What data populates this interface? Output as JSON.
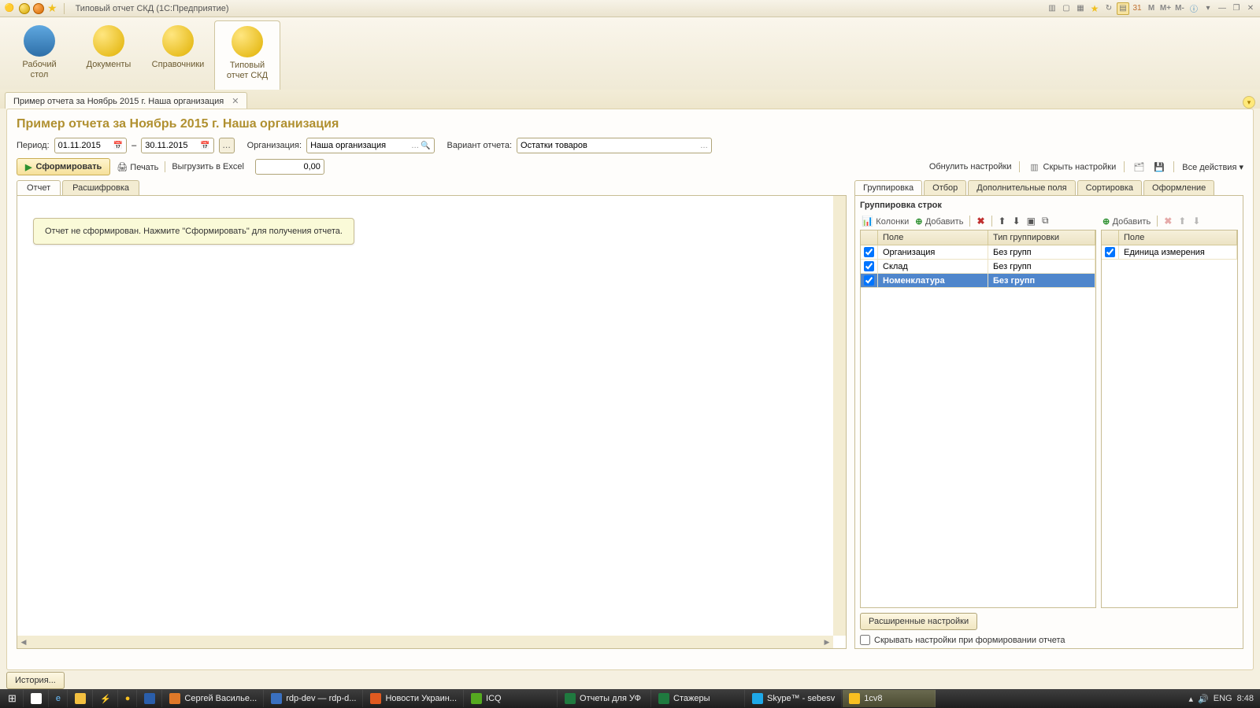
{
  "titlebar": {
    "title": "Типовый отчет СКД  (1С:Предприятие)",
    "memory": {
      "m": "M",
      "mplus": "M+",
      "mminus": "M-"
    }
  },
  "nav": {
    "items": [
      {
        "label": "Рабочий\nстол"
      },
      {
        "label": "Документы"
      },
      {
        "label": "Справочники"
      },
      {
        "label": "Типовый\nотчет СКД"
      }
    ]
  },
  "doctab": {
    "label": "Пример отчета за Ноябрь 2015 г. Наша организация"
  },
  "page": {
    "title": "Пример отчета за Ноябрь 2015 г. Наша организация",
    "period_label": "Период:",
    "period_from": "01.11.2015",
    "period_to": "30.11.2015",
    "dash": "–",
    "org_label": "Организация:",
    "org_value": "Наша организация",
    "variant_label": "Вариант отчета:",
    "variant_value": "Остатки товаров",
    "form_btn": "Сформировать",
    "print_btn": "Печать",
    "export_btn": "Выгрузить в Excel",
    "num_value": "0,00",
    "reset_link": "Обнулить настройки",
    "hide_link": "Скрыть настройки",
    "all_actions": "Все действия",
    "tabs": {
      "report": "Отчет",
      "drill": "Расшифровка"
    },
    "placeholder_msg": "Отчет не сформирован. Нажмите \"Сформировать\" для получения отчета."
  },
  "right": {
    "tabs": [
      "Группировка",
      "Отбор",
      "Дополнительные поля",
      "Сортировка",
      "Оформление"
    ],
    "title": "Группировка строк",
    "btn_columns": "Колонки",
    "btn_add": "Добавить",
    "gridA": {
      "h1": "Поле",
      "h2": "Тип группировки",
      "rows": [
        {
          "f": "Организация",
          "t": "Без групп",
          "sel": false
        },
        {
          "f": "Склад",
          "t": "Без групп",
          "sel": false
        },
        {
          "f": "Номенклатура",
          "t": "Без групп",
          "sel": true
        }
      ]
    },
    "gridB": {
      "h1": "Поле",
      "btn_add": "Добавить",
      "rows": [
        {
          "f": "Единица измерения"
        }
      ]
    },
    "adv_btn": "Расширенные настройки",
    "hide_chk": "Скрывать настройки при формировании отчета"
  },
  "history": {
    "btn": "История..."
  },
  "taskbar": {
    "tasks": [
      "Сергей Василье...",
      "rdp-dev — rdp-d...",
      "Новости Украин...",
      "ICQ",
      "Отчеты для УФ",
      "Стажеры",
      "Skype™ - sebesv",
      "1cv8"
    ],
    "lang": "ENG",
    "time": "8:48"
  }
}
